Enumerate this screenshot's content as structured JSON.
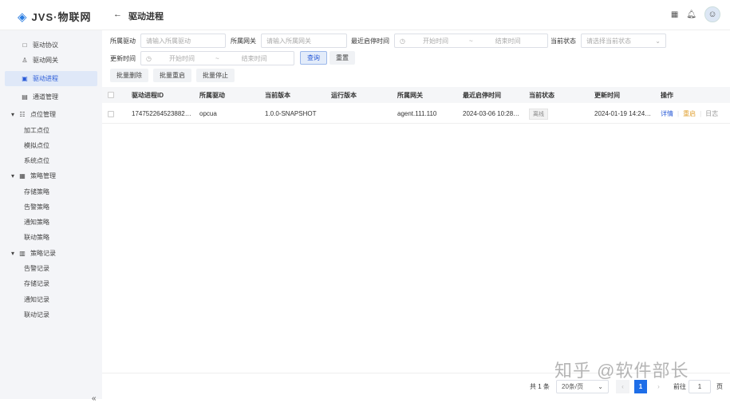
{
  "app": {
    "name": "JVS·物联网",
    "page_title": "驱动进程",
    "back_icon": "←"
  },
  "sidebar": {
    "items": [
      {
        "label": "驱动协议",
        "icon": "□"
      },
      {
        "label": "驱动网关",
        "icon": "♙"
      },
      {
        "label": "驱动进程",
        "icon": "▣",
        "active": true
      },
      {
        "label": "通道管理",
        "icon": "▤"
      },
      {
        "label": "点位管理",
        "icon": "☷",
        "group": true
      },
      {
        "label": "加工点位"
      },
      {
        "label": "模拟点位"
      },
      {
        "label": "系统点位"
      },
      {
        "label": "策略管理",
        "icon": "▦",
        "group": true
      },
      {
        "label": "存储策略"
      },
      {
        "label": "告警策略"
      },
      {
        "label": "通知策略"
      },
      {
        "label": "联动策略"
      },
      {
        "label": "策略记录",
        "icon": "▥",
        "group": true
      },
      {
        "label": "告警记录"
      },
      {
        "label": "存储记录"
      },
      {
        "label": "通知记录"
      },
      {
        "label": "联动记录"
      }
    ],
    "collapse": "«"
  },
  "filters": {
    "driver_label": "所属驱动",
    "driver_placeholder": "请输入所属驱动",
    "gateway_label": "所属网关",
    "gateway_placeholder": "请输入所属网关",
    "last_start_label": "最近启停时间",
    "start_placeholder": "开始时间",
    "sep": "~",
    "end_placeholder": "结束时间",
    "status_label": "当前状态",
    "status_placeholder": "请选择当前状态",
    "update_label": "更新时间",
    "query": "查询",
    "reset": "重置"
  },
  "actions": {
    "batch_delete": "批量删除",
    "batch_restart": "批量重启",
    "batch_stop": "批量停止"
  },
  "table": {
    "columns": [
      "驱动进程ID",
      "所属驱动",
      "当前版本",
      "运行版本",
      "所属网关",
      "最近启停时间",
      "当前状态",
      "更新时间",
      "操作"
    ],
    "rows": [
      {
        "id": "174752264523882…",
        "driver": "opcua",
        "version": "1.0.0-SNAPSHOT",
        "run_version": "",
        "gateway": "agent.111.110",
        "last_start": "2024-03-06 10:28…",
        "status": "离线",
        "updated": "2024-01-19 14:24…",
        "op_detail": "详情",
        "op_restart": "重启",
        "op_log": "日志"
      }
    ]
  },
  "pagination": {
    "total": "共 1 条",
    "page_size": "20条/页",
    "current": "1",
    "goto_label": "前往",
    "goto_value": "1",
    "page_suffix": "页"
  },
  "watermark": "知乎 @软件部长"
}
